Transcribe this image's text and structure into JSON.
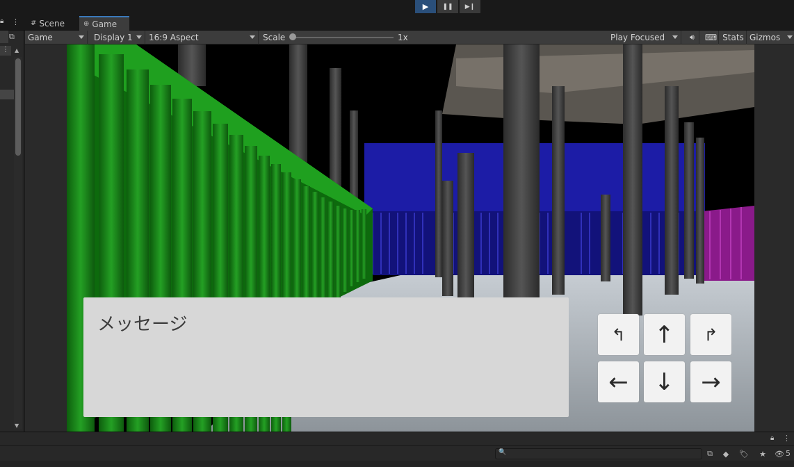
{
  "playbar": {
    "play_glyph": "▶",
    "pause_glyph": "❚❚",
    "step_glyph": "▶❙"
  },
  "tabs": [
    {
      "label": "Scene",
      "icon": "#"
    },
    {
      "label": "Game",
      "icon": "⊕"
    }
  ],
  "toolbar": {
    "display_mode": "Game",
    "display": "Display 1",
    "aspect": "16:9 Aspect",
    "scale_label": "Scale",
    "scale_value": "1x",
    "play_mode": "Play Focused",
    "stats": "Stats",
    "gizmos": "Gizmos"
  },
  "game": {
    "message": "メッセージ",
    "controls": {
      "turn_left": "↰",
      "forward": "↑",
      "turn_right": "↱",
      "left": "←",
      "back": "↓",
      "right": "→"
    }
  },
  "bottom": {
    "hidden_count": "5",
    "search_icon": "🔍"
  },
  "colors": {
    "accent": "#3a79bb",
    "play_active": "#2a4f7a",
    "panel": "#282828",
    "green_fence": "#1e8c1e",
    "blue_wall": "#1f1fa0",
    "magenta_wall": "#a020a0"
  }
}
